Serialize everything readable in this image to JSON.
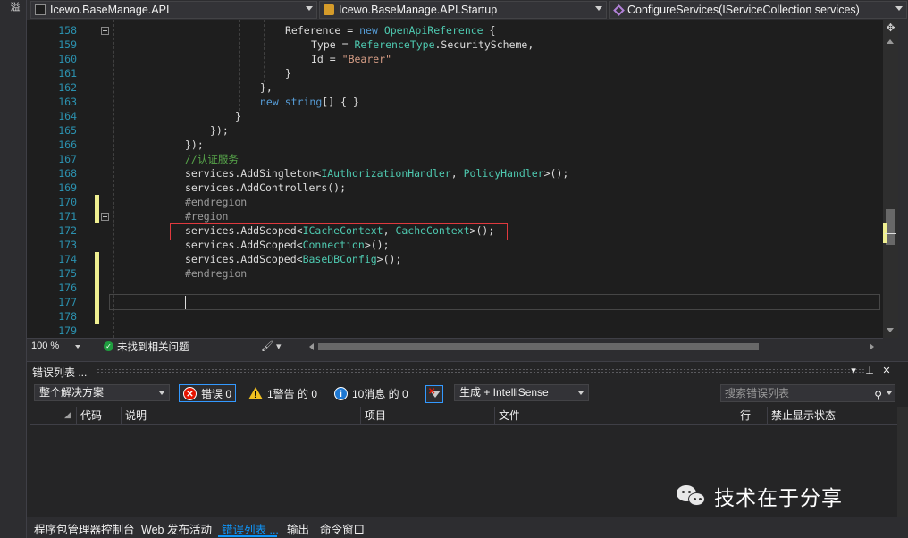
{
  "left_strip": {
    "tab_label": "溢"
  },
  "nav": {
    "project": "Icewo.BaseManage.API",
    "class": "Icewo.BaseManage.API.Startup",
    "member": "ConfigureServices(IServiceCollection services)"
  },
  "editor": {
    "line_numbers": [
      "158",
      "159",
      "160",
      "161",
      "162",
      "163",
      "164",
      "165",
      "166",
      "167",
      "168",
      "169",
      "170",
      "171",
      "172",
      "173",
      "174",
      "175",
      "176",
      "177",
      "178",
      "179"
    ],
    "lines": {
      "l158": {
        "a": "Reference",
        "b": " = ",
        "c": "new",
        "d": " ",
        "e": "OpenApiReference",
        "f": " {"
      },
      "l159": {
        "a": "Type",
        "b": " = ",
        "c": "ReferenceType",
        "d": ".SecurityScheme,"
      },
      "l160": {
        "a": "Id",
        "b": " = ",
        "c": "\"Bearer\""
      },
      "l161": {
        "a": "}"
      },
      "l162": {
        "a": "},"
      },
      "l163": {
        "a": "new",
        "b": " ",
        "c": "string",
        "d": "[] { }"
      },
      "l164": {
        "a": "}"
      },
      "l165": {
        "a": "});"
      },
      "l166": {
        "a": "});"
      },
      "l167": {
        "a": "//认证服务"
      },
      "l168": {
        "a": "services.AddSingleton<",
        "b": "IAuthorizationHandler",
        "c": ", ",
        "d": "PolicyHandler",
        "e": ">();"
      },
      "l169": {
        "a": "services.AddControllers();"
      },
      "l170": {
        "a": "#endregion"
      },
      "l171": {
        "a": "#region"
      },
      "l172": {
        "a": "services.AddScoped<",
        "b": "ICacheContext",
        "c": ", ",
        "d": "CacheContext",
        "e": ">();"
      },
      "l173": {
        "a": "services.AddScoped<",
        "b": "Connection",
        "c": ">();"
      },
      "l174": {
        "a": "services.AddScoped<",
        "b": "BaseDBConfig",
        "c": ">();"
      },
      "l175": {
        "a": "#endregion"
      }
    },
    "zoom": "100 %",
    "issues_text": "未找到相关问题"
  },
  "error_list": {
    "title": "错误列表 ...",
    "scope_dropdown": "整个解决方案",
    "errors_label": "错误 0",
    "warnings_label": "1警告 的 0",
    "messages_label": "10消息 的 0",
    "build_dropdown": "生成 + IntelliSense",
    "search_placeholder": "搜索错误列表",
    "columns": [
      "代码",
      "说明",
      "项目",
      "文件",
      "行",
      "禁止显示状态"
    ],
    "rows": []
  },
  "watermark": {
    "text": "技术在于分享"
  },
  "bottom_tabs": [
    "程序包管理器控制台",
    "Web 发布活动",
    "错误列表 ...",
    "输出",
    "命令窗口"
  ],
  "colors": {
    "keyword": "#569cd6",
    "type": "#4ec9b0",
    "string": "#d69d85",
    "comment": "#57a64a",
    "line_number": "#2b91af",
    "highlight_border": "#e0393e",
    "active_tab": "#0e97fd"
  }
}
